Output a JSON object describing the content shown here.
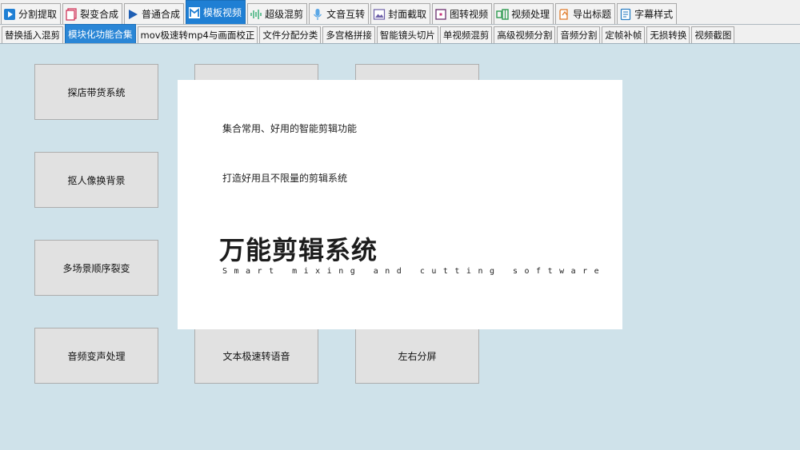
{
  "top_tabs": [
    {
      "label": "分割提取",
      "icon": "play-box-icon"
    },
    {
      "label": "裂变合成",
      "icon": "copy-pages-icon"
    },
    {
      "label": "普通合成",
      "icon": "play-triangle-icon"
    },
    {
      "label": "模板视频",
      "icon": "template-icon",
      "active": true
    },
    {
      "label": "超级混剪",
      "icon": "waveform-icon"
    },
    {
      "label": "文音互转",
      "icon": "microphone-icon"
    },
    {
      "label": "封面截取",
      "icon": "image-icon"
    },
    {
      "label": "图转视频",
      "icon": "photo-video-icon"
    },
    {
      "label": "视频处理",
      "icon": "video-process-icon"
    },
    {
      "label": "导出标题",
      "icon": "export-title-icon"
    },
    {
      "label": "字幕样式",
      "icon": "subtitle-doc-icon"
    }
  ],
  "sub_tabs": [
    {
      "label": "替换插入混剪"
    },
    {
      "label": "模块化功能合集",
      "active": true
    },
    {
      "label": "mov极速转mp4与画面校正"
    },
    {
      "label": "文件分配分类"
    },
    {
      "label": "多宫格拼接"
    },
    {
      "label": "智能镜头切片"
    },
    {
      "label": "单视频混剪"
    },
    {
      "label": "高级视频分割"
    },
    {
      "label": "音频分割"
    },
    {
      "label": "定帧补帧"
    },
    {
      "label": "无损转换"
    },
    {
      "label": "视频截图"
    }
  ],
  "function_buttons": [
    {
      "label": "探店带货系统"
    },
    {
      "label": "抠人像换背景"
    },
    {
      "label": "多场景顺序裂变"
    },
    {
      "label": "音频变声处理"
    },
    {
      "label": "文本极速转语音"
    },
    {
      "label": "左右分屏"
    }
  ],
  "splash": {
    "line1": "集合常用、好用的智能剪辑功能",
    "line2": "打造好用且不限量的剪辑系统",
    "title": "万能剪辑系统",
    "subtitle": "Smart mixing and cutting software"
  },
  "colors": {
    "background": "#cfe2ea",
    "active_tab": "#1f7fd4",
    "button_face": "#e1e1e1"
  }
}
